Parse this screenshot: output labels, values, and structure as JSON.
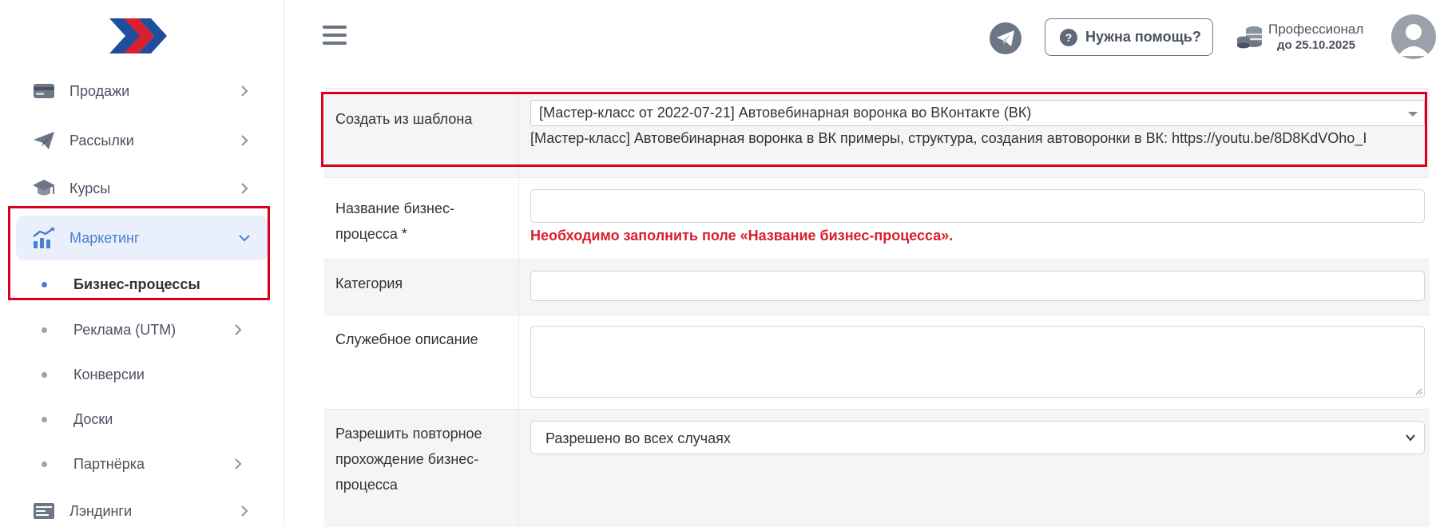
{
  "sidebar": {
    "items": [
      {
        "label": "Продажи",
        "icon": "wallet-icon"
      },
      {
        "label": "Рассылки",
        "icon": "paper-plane-icon"
      },
      {
        "label": "Курсы",
        "icon": "graduation-cap-icon"
      },
      {
        "label": "Маркетинг",
        "icon": "chart-icon"
      }
    ],
    "marketing_sub": [
      {
        "label": "Бизнес-процессы"
      },
      {
        "label": "Реклама (UTM)"
      },
      {
        "label": "Конверсии"
      },
      {
        "label": "Доски"
      },
      {
        "label": "Партнёрка"
      }
    ],
    "landings": {
      "label": "Лэндинги",
      "icon": "landing-icon"
    }
  },
  "header": {
    "help_label": "Нужна помощь?",
    "help_icon": "?",
    "plan_name": "Профессионал",
    "plan_date": "до 25.10.2025"
  },
  "form": {
    "template": {
      "label": "Создать из шаблона",
      "selected": "[Мастер-класс от 2022-07-21] Автовебинарная воронка во ВКонтакте (ВК)",
      "description": "[Мастер-класс] Автовебинарная воронка в ВК примеры, структура, создания автоворонки в ВК: https://youtu.be/8D8KdVOho_I"
    },
    "name": {
      "label": "Название бизнес-процесса *",
      "value": "",
      "error": "Необходимо заполнить поле «Название бизнес-процесса»."
    },
    "category": {
      "label": "Категория",
      "value": ""
    },
    "description": {
      "label": "Служебное описание",
      "value": ""
    },
    "repeat": {
      "label": "Разрешить повторное прохождение бизнес-процесса",
      "selected": "Разрешено во всех случаях"
    }
  },
  "colors": {
    "accent": "#4a7fd0",
    "highlight": "#d9001b",
    "error": "#d9202c"
  }
}
